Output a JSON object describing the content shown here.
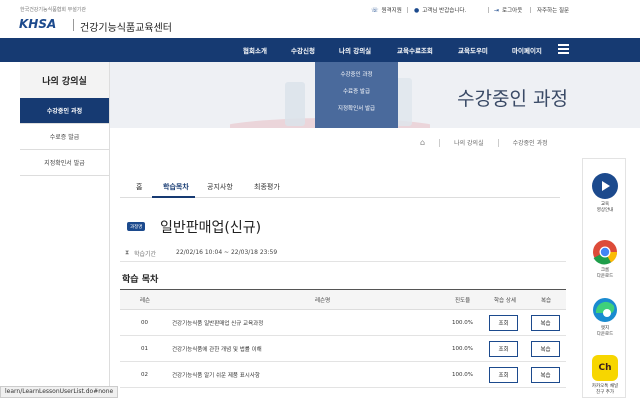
{
  "header": {
    "logo_tagline": "한국건강기능식품협회 부설기관",
    "logo_text": "KHSA",
    "site_name": "건강기능식품교육센터",
    "utils": [
      {
        "icon": "remote-support-icon",
        "label": "원격지원"
      },
      {
        "icon": "user-icon",
        "label": "고객님 반갑습니다."
      },
      {
        "icon": "logout-icon",
        "label": "로그아웃"
      },
      {
        "icon": "faq-icon",
        "label": "자주하는 질문"
      }
    ]
  },
  "nav": {
    "items": [
      "협회소개",
      "수강신청",
      "나의 강의실",
      "교육수료조회",
      "교육도우미",
      "마이페이지"
    ],
    "dropdown": [
      "수강중인 과정",
      "수료증 발급",
      "지정확인서 발급"
    ]
  },
  "banner": {
    "title": "수강중인 과정"
  },
  "sidebar": {
    "title": "나의 강의실",
    "items": [
      "수강중인 과정",
      "수료증 발급",
      "지정확인서 발급"
    ]
  },
  "breadcrumb": {
    "home_icon": "home-icon",
    "items": [
      "나의 강의실",
      "수강중인 과정"
    ]
  },
  "tabs": [
    "홈",
    "학습목차",
    "공지사항",
    "최종평가"
  ],
  "course": {
    "badge": "과정명",
    "title": "일반판매업(신규)",
    "period_label": "학습기간",
    "period_value": "22/02/16 10:04 ~ 22/03/18 23:59"
  },
  "toc": {
    "title": "학습 목차",
    "headers": [
      "레슨",
      "레슨명",
      "진도율",
      "학습 상세",
      "복습"
    ],
    "rows": [
      {
        "lesson": "00",
        "name": "건강기능식품 일반판매업 신규 교육과정",
        "progress": "100.0%",
        "detail": "조회",
        "review": "복습"
      },
      {
        "lesson": "01",
        "name": "건강기능식품에 관한 개념 및 법률 이해",
        "progress": "100.0%",
        "detail": "조회",
        "review": "복습"
      },
      {
        "lesson": "02",
        "name": "건강기능식품 알기 쉬운 제품 표시사항",
        "progress": "100.0%",
        "detail": "조회",
        "review": "복습"
      }
    ]
  },
  "quick": [
    {
      "icon": "play-icon",
      "label1": "교육",
      "label2": "영상안내",
      "color": "#1c4a8d"
    },
    {
      "icon": "chrome-icon",
      "label1": "크롬",
      "label2": "다운로드",
      "color": "#dd4b39"
    },
    {
      "icon": "edge-icon",
      "label1": "엣지",
      "label2": "다운로드",
      "color": "#1a8bd0"
    },
    {
      "icon": "kakao-channel-icon",
      "label1": "카카오톡 채널",
      "label2": "친구 추가",
      "color": "#f7d600"
    }
  ],
  "status_url": "learn/LearnLessonUserList.do#none"
}
